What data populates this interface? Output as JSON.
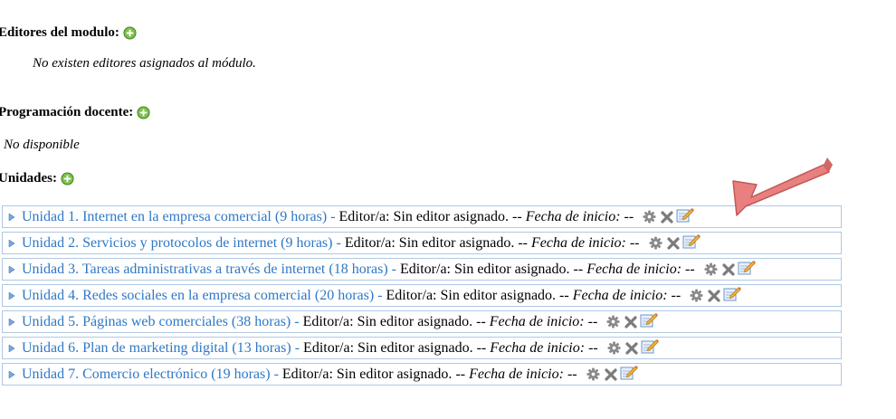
{
  "sections": {
    "editors_title": "Editores del modulo:",
    "editors_empty": "No existen editores asignados al módulo.",
    "programming_title": "Programación docente:",
    "programming_value": "No disponible",
    "units_title": "Unidades:"
  },
  "units": [
    {
      "link": "Unidad 1. Internet en la empresa comercial (9 horas)",
      "sep": "-",
      "editor": "Editor/a: Sin editor asignado.",
      "dash1": "--",
      "fecha_label": "Fecha de inicio:",
      "dash2": "--"
    },
    {
      "link": "Unidad 2. Servicios y protocolos de internet (9 horas)",
      "sep": "-",
      "editor": "Editor/a: Sin editor asignado.",
      "dash1": "--",
      "fecha_label": "Fecha de inicio:",
      "dash2": "--"
    },
    {
      "link": "Unidad 3. Tareas administrativas a través de internet (18 horas)",
      "sep": "-",
      "editor": "Editor/a: Sin editor asignado.",
      "dash1": "--",
      "fecha_label": "Fecha de inicio:",
      "dash2": "--"
    },
    {
      "link": "Unidad 4. Redes sociales en la empresa comercial (20 horas)",
      "sep": "-",
      "editor": "Editor/a: Sin editor asignado.",
      "dash1": "--",
      "fecha_label": "Fecha de inicio:",
      "dash2": "--"
    },
    {
      "link": "Unidad 5. Páginas web comerciales (38 horas)",
      "sep": "-",
      "editor": "Editor/a: Sin editor asignado.",
      "dash1": "--",
      "fecha_label": "Fecha de inicio:",
      "dash2": "--"
    },
    {
      "link": "Unidad 6. Plan de marketing digital (13 horas)",
      "sep": "-",
      "editor": "Editor/a: Sin editor asignado.",
      "dash1": "--",
      "fecha_label": "Fecha de inicio:",
      "dash2": "--"
    },
    {
      "link": "Unidad 7. Comercio electrónico (19 horas)",
      "sep": "-",
      "editor": "Editor/a: Sin editor asignado.",
      "dash1": "--",
      "fecha_label": "Fecha de inicio:",
      "dash2": "--"
    }
  ],
  "colors": {
    "link": "#2e78c6",
    "row_border": "#b0c8e4",
    "annotation_arrow": "#e88080"
  },
  "icons": [
    "add-icon",
    "bullet-icon",
    "gear-icon",
    "delete-icon",
    "edit-icon",
    "annotation-arrow"
  ]
}
